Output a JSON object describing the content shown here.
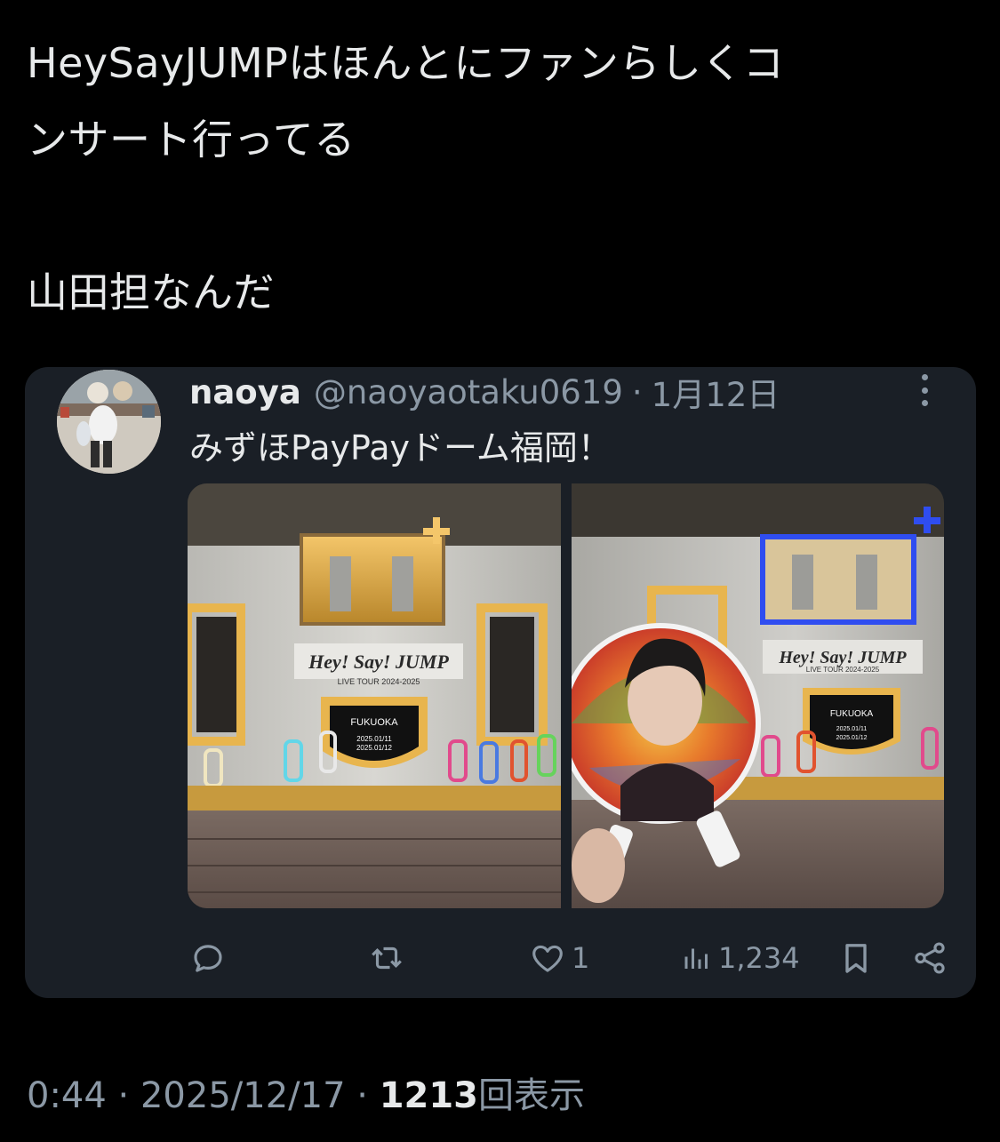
{
  "post": {
    "text_line1": "HeySayJUMPはほんとにファンらしくコ",
    "text_line2": "ンサート行ってる",
    "text_line3": "山田担なんだ"
  },
  "quote": {
    "name": "naoya",
    "handle": "@naoyaotaku0619",
    "separator": "·",
    "date": "1月12日",
    "text": "みずほPayPayドーム福岡！",
    "photo_left": {
      "sign_title": "Hey! Say! JUMP",
      "sign_sub": "LIVE TOUR 2024-2025",
      "plate_city": "FUKUOKA",
      "plate_date1": "2025.01/11",
      "plate_date2": "2025.01/12"
    },
    "photo_right": {
      "sign_title": "Hey! Say! JUMP",
      "sign_sub": "LIVE TOUR 2024-2025",
      "plate_city": "FUKUOKA",
      "plate_date1": "2025.01/11",
      "plate_date2": "2025.01/12"
    },
    "actions": {
      "reply_icon": "reply-icon",
      "repost_icon": "repost-icon",
      "like_icon": "heart-icon",
      "like_count": "1",
      "views_icon": "views-chart-icon",
      "views_count": "1,234",
      "bookmark_icon": "bookmark-icon",
      "share_icon": "share-icon"
    }
  },
  "meta": {
    "time": "0:44",
    "sep1": "·",
    "date": "2025/12/17",
    "sep2": "·",
    "views_count": "1213",
    "views_label": "回表示"
  },
  "colors": {
    "background": "#000000",
    "card": "#1a1f26",
    "text": "#e7e9ea",
    "muted": "#8b98a5"
  }
}
